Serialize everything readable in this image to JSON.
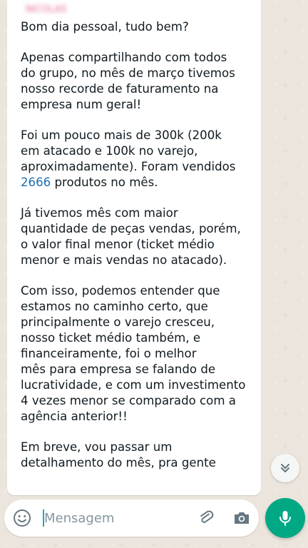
{
  "chat": {
    "sender_name": "NICOLAS",
    "message": {
      "greeting": "Bom dia pessoal, tudo bem?",
      "p1": [
        "Apenas compartilhando com todos",
        "do grupo, no mês de março tivemos",
        "nosso recorde de faturamento na",
        "empresa num geral!"
      ],
      "p2": [
        "Foi um pouco mais de 300k (200k",
        "em atacado e 100k no varejo,",
        "aproximadamente). Foram vendidos"
      ],
      "p2_last": {
        "number": "2666",
        "rest": " produtos no mês."
      },
      "p3": [
        "Já tivemos mês com maior",
        "quantidade de peças vendas, porém,",
        "o valor final menor (ticket médio",
        "menor e mais vendas no atacado)."
      ],
      "p4": [
        "Com isso, podemos entender que",
        "estamos no caminho certo, que",
        "principalmente o varejo cresceu,",
        "nosso ticket médio também, e",
        "financeiramente, foi o melhor",
        "mês para empresa se falando de",
        "lucratividade, e com um investimento",
        "4 vezes menor se comparado com a",
        "agência anterior!!"
      ],
      "p5": [
        "Em breve, vou passar um",
        "detalhamento do mês, pra gente"
      ]
    }
  },
  "input": {
    "placeholder": "Mensagem"
  },
  "icons": {
    "scroll_down": "double-chevron-down-icon",
    "emoji": "emoji-icon",
    "attach": "paperclip-icon",
    "camera": "camera-icon",
    "mic": "microphone-icon"
  },
  "colors": {
    "accent": "#00a884",
    "link": "#1f6fb2",
    "background": "#ece5dd"
  }
}
